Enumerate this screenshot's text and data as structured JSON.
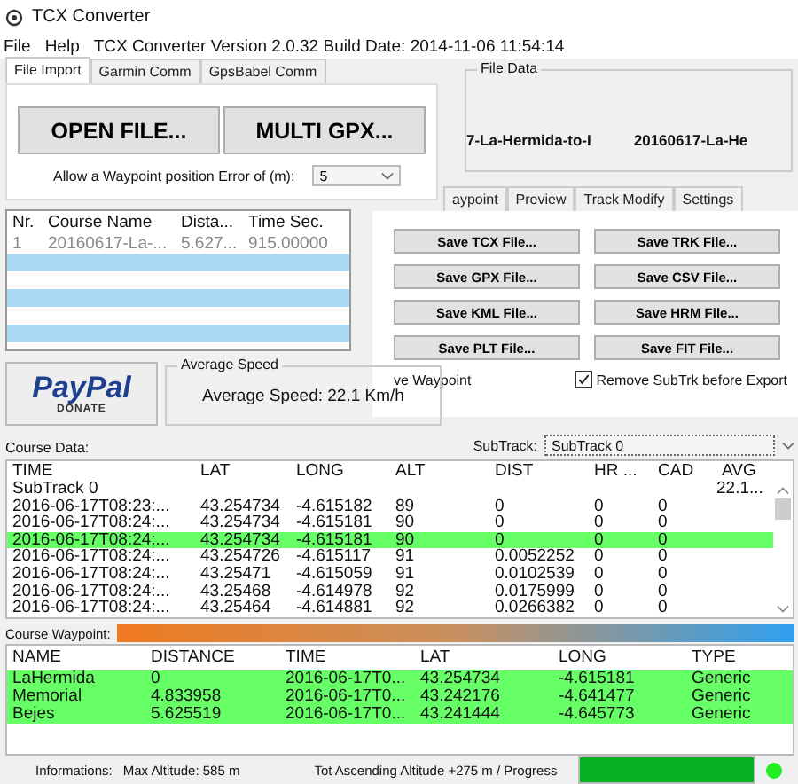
{
  "window": {
    "title": "TCX Converter"
  },
  "menu": [
    "File",
    "Help"
  ],
  "version": "TCX Converter Version 2.0.32 Build Date: 2014-11-06 11:54:14",
  "import_tabs": [
    {
      "label": "File Import",
      "selected": true
    },
    {
      "label": "Garmin Comm",
      "selected": false
    },
    {
      "label": "GpsBabel Comm",
      "selected": false
    }
  ],
  "open_buttons": [
    "OPEN FILE...",
    "MULTI GPX..."
  ],
  "waypoint_error": {
    "label": "Allow a Waypoint position Error of (m):",
    "value": "5"
  },
  "course_list": {
    "columns": [
      "Nr.",
      "Course Name",
      "Dista...",
      "Time Sec."
    ],
    "rows": [
      [
        "1",
        "20160617-La-...",
        "5.627...",
        "915.00000"
      ]
    ]
  },
  "donate_button": {
    "logo": "PayPal",
    "label": "DONATE"
  },
  "average_speed": {
    "title": "Average Speed",
    "text": "Average Speed: 22.1 Km/h"
  },
  "file_data": {
    "title": "File Data",
    "values": [
      "7-La-Hermida-to-I",
      "20160617-La-He"
    ]
  },
  "tool_tabs": [
    {
      "label": "aypoint",
      "selected": false
    },
    {
      "label": "Preview",
      "selected": false
    },
    {
      "label": "Track Modify",
      "selected": false
    },
    {
      "label": "Settings",
      "selected": false
    }
  ],
  "save_buttons": [
    "Save TCX File...",
    "Save TRK File...",
    "Save GPX File...",
    "Save CSV File...",
    "Save KML File...",
    "Save HRM File...",
    "Save PLT File...",
    "Save FIT File..."
  ],
  "save_waypoint_label": "ve Waypoint",
  "remove_subtrk": {
    "label": "Remove SubTrk before Export",
    "checked": true
  },
  "course_data": {
    "label": "Course Data:",
    "subtrack_label": "SubTrack:",
    "subtrack_value": "SubTrack 0",
    "columns": [
      "TIME",
      "LAT",
      "LONG",
      "ALT",
      "DIST",
      "HR ...",
      "CAD",
      "AVG"
    ],
    "rows": [
      {
        "kind": "group",
        "label": "SubTrack 0",
        "avg": "22.1..."
      },
      {
        "kind": "point",
        "selected": false,
        "cells": [
          "2016-06-17T08:23:...",
          "43.254734",
          "-4.615182",
          "89",
          "0",
          "0",
          "0"
        ]
      },
      {
        "kind": "point",
        "selected": false,
        "cells": [
          "2016-06-17T08:24:...",
          "43.254734",
          "-4.615181",
          "90",
          "0",
          "0",
          "0"
        ]
      },
      {
        "kind": "point",
        "selected": true,
        "cells": [
          "2016-06-17T08:24:...",
          "43.254734",
          "-4.615181",
          "90",
          "0",
          "0",
          "0"
        ]
      },
      {
        "kind": "point",
        "selected": false,
        "cells": [
          "2016-06-17T08:24:...",
          "43.254726",
          "-4.615117",
          "91",
          "0.0052252",
          "0",
          "0"
        ]
      },
      {
        "kind": "point",
        "selected": false,
        "cells": [
          "2016-06-17T08:24:...",
          "43.25471",
          "-4.615059",
          "91",
          "0.0102539",
          "0",
          "0"
        ]
      },
      {
        "kind": "point",
        "selected": false,
        "cells": [
          "2016-06-17T08:24:...",
          "43.25468",
          "-4.614978",
          "92",
          "0.0175999",
          "0",
          "0"
        ]
      },
      {
        "kind": "point",
        "selected": false,
        "cells": [
          "2016-06-17T08:24:...",
          "43.25464",
          "-4.614881",
          "92",
          "0.0266382",
          "0",
          "0"
        ]
      }
    ]
  },
  "waypoints": {
    "label": "Course Waypoint:",
    "columns": [
      "NAME",
      "DISTANCE",
      "TIME",
      "LAT",
      "LONG",
      "TYPE"
    ],
    "rows": [
      {
        "selected": true,
        "cells": [
          "LaHermida",
          "0",
          "2016-06-17T0...",
          "43.254734",
          "-4.615181",
          "Generic"
        ]
      },
      {
        "selected": true,
        "cells": [
          "Memorial",
          "4.833958",
          "2016-06-17T0...",
          "43.242176",
          "-4.641477",
          "Generic"
        ]
      },
      {
        "selected": true,
        "cells": [
          "Bejes",
          "5.625519",
          "2016-06-17T0...",
          "43.241444",
          "-4.645773",
          "Generic"
        ]
      }
    ]
  },
  "status": {
    "label": "Informations:",
    "max_altitude": "Max Altitude: 585 m",
    "ascending": "Tot Ascending Altitude +275 m / Progress",
    "progress": {
      "level": 1
    },
    "indicator_on": true
  }
}
